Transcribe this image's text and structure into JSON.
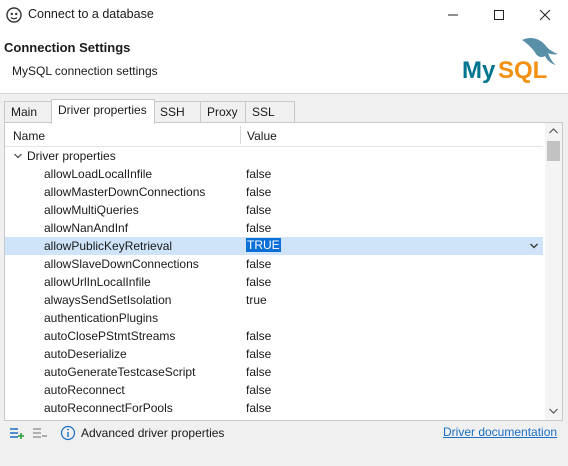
{
  "window": {
    "title": "Connect to a database"
  },
  "header": {
    "title": "Connection Settings",
    "subtitle": "MySQL connection settings",
    "logo_text": "MySQL"
  },
  "tabs": [
    {
      "label": "Main",
      "active": false
    },
    {
      "label": "Driver properties",
      "active": true
    },
    {
      "label": "SSH",
      "active": false
    },
    {
      "label": "Proxy",
      "active": false
    },
    {
      "label": "SSL",
      "active": false
    }
  ],
  "table": {
    "col_name": "Name",
    "col_value": "Value",
    "group_label": "Driver properties",
    "rows": [
      {
        "name": "allowLoadLocalInfile",
        "value": "false"
      },
      {
        "name": "allowMasterDownConnections",
        "value": "false"
      },
      {
        "name": "allowMultiQueries",
        "value": "false"
      },
      {
        "name": "allowNanAndInf",
        "value": "false"
      },
      {
        "name": "allowPublicKeyRetrieval",
        "value": "TRUE"
      },
      {
        "name": "allowSlaveDownConnections",
        "value": "false"
      },
      {
        "name": "allowUrlInLocalInfile",
        "value": "false"
      },
      {
        "name": "alwaysSendSetIsolation",
        "value": "true"
      },
      {
        "name": "authenticationPlugins",
        "value": ""
      },
      {
        "name": "autoClosePStmtStreams",
        "value": "false"
      },
      {
        "name": "autoDeserialize",
        "value": "false"
      },
      {
        "name": "autoGenerateTestcaseScript",
        "value": "false"
      },
      {
        "name": "autoReconnect",
        "value": "false"
      },
      {
        "name": "autoReconnectForPools",
        "value": "false"
      }
    ],
    "selected_row": "allowPublicKeyRetrieval"
  },
  "footer": {
    "advanced_label": "Advanced driver properties",
    "doc_link": "Driver documentation"
  },
  "colors": {
    "selection_bg": "#cfe4f8",
    "value_highlight": "#0b6fd6",
    "link": "#1a6fc2",
    "logo_blue": "#00758f",
    "logo_orange": "#f29111"
  }
}
